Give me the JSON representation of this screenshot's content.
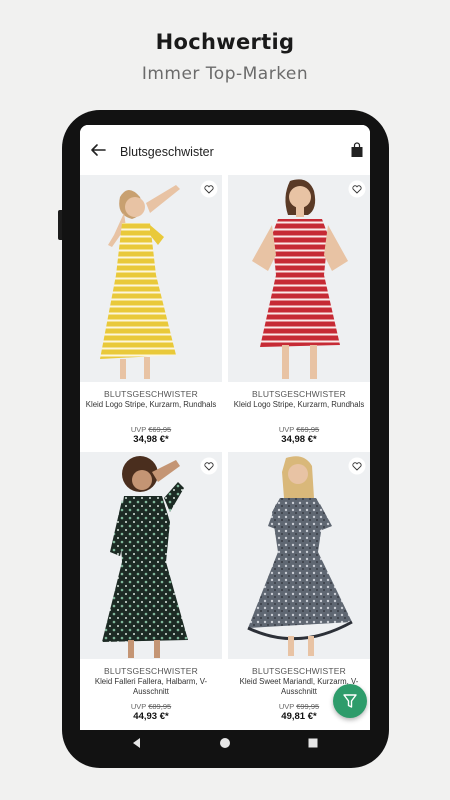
{
  "promo": {
    "title": "Hochwertig",
    "subtitle": "Immer Top-Marken"
  },
  "appbar": {
    "title": "Blutsgeschwister",
    "back_icon": "arrow-left-icon",
    "bag_icon": "shopping-bag-icon"
  },
  "products": [
    {
      "brand": "BLUTSGESCHWISTER",
      "name": "Kleid Logo Stripe, Kurzarm, Rundhals",
      "uvp_label": "UVP",
      "uvp": "€69,95",
      "price": "34,98 €*",
      "dress_color": "#e9c93a",
      "stripe_color": "#fdf6dc"
    },
    {
      "brand": "BLUTSGESCHWISTER",
      "name": "Kleid Logo Stripe, Kurzarm, Rundhals",
      "uvp_label": "UVP",
      "uvp": "€69,95",
      "price": "34,98 €*",
      "dress_color": "#c62a35",
      "stripe_color": "#fbe9e9"
    },
    {
      "brand": "BLUTSGESCHWISTER",
      "name": "Kleid Falleri Fallera, Halbarm, V-Ausschnitt",
      "uvp_label": "UVP",
      "uvp": "€89,95",
      "price": "44,93 €*",
      "dress_color": "#1c2a24",
      "stripe_color": "#7fb59a"
    },
    {
      "brand": "BLUTSGESCHWISTER",
      "name": "Kleid Sweet Mariandl, Kurzarm, V-Ausschnitt",
      "uvp_label": "UVP",
      "uvp": "€99,95",
      "price": "49,81 €*",
      "dress_color": "#5f6772",
      "stripe_color": "#c9cdd4"
    }
  ],
  "fab_icon": "filter-icon",
  "colors": {
    "accent": "#2e9c6b",
    "background": "#f1f1f0"
  }
}
